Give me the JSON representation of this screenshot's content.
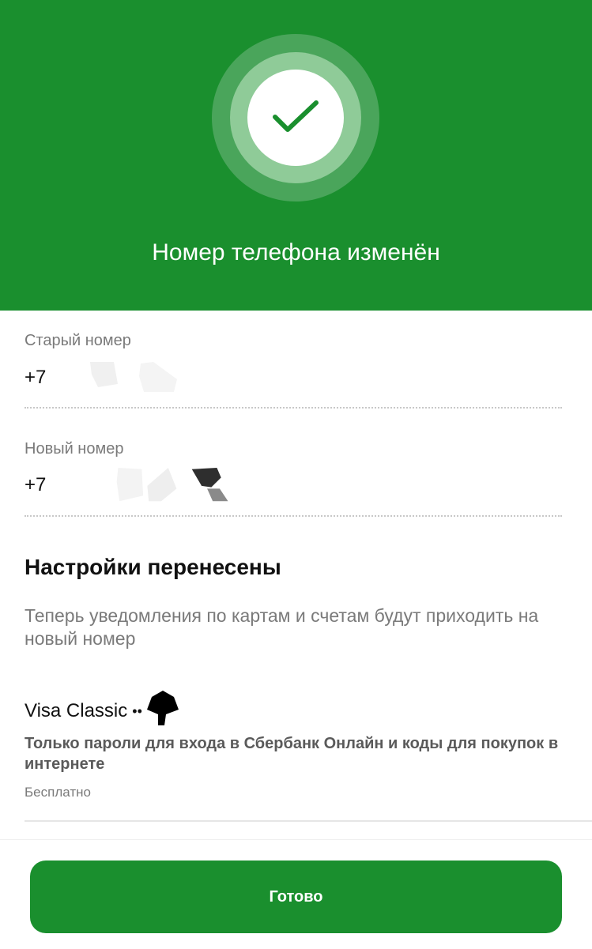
{
  "header": {
    "title": "Номер телефона изменён",
    "icon": "checkmark-icon",
    "accent_color": "#1a8f2e"
  },
  "old_number": {
    "label": "Старый номер",
    "prefix": "+7"
  },
  "new_number": {
    "label": "Новый номер",
    "prefix": "+7"
  },
  "settings": {
    "title": "Настройки перенесены",
    "description": "Теперь уведомления по картам и счетам будут приходить на новый номер"
  },
  "card": {
    "name": "Visa Classic",
    "mask": "••",
    "description": "Только пароли для входа в Сбербанк Онлайн и коды для покупок в интернете",
    "price": "Бесплатно"
  },
  "footer": {
    "done_label": "Готово"
  }
}
